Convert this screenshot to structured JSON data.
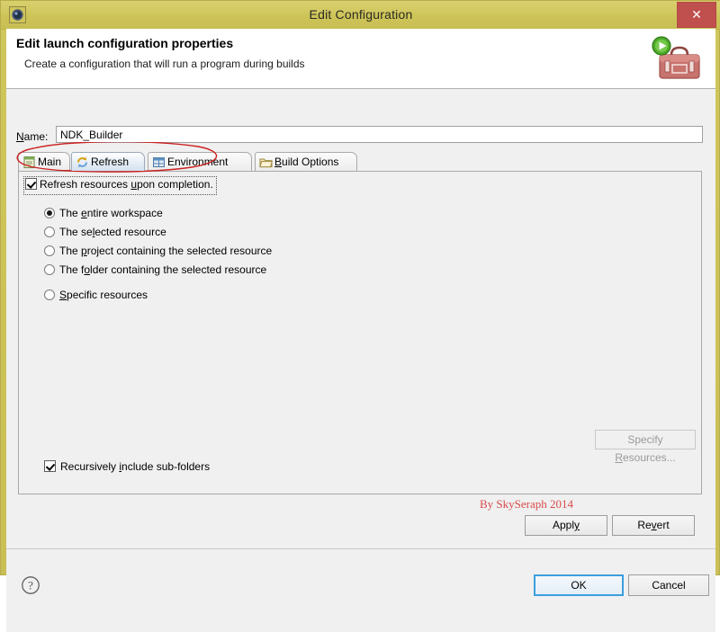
{
  "window": {
    "title": "Edit Configuration",
    "icon": "gear-icon",
    "close_label": "✕",
    "titlebar_color": "#cdc357",
    "close_color": "#c0504d"
  },
  "banner": {
    "title": "Edit launch configuration properties",
    "subtitle": "Create a configuration that will run a program during builds",
    "icon": "toolbox-with-run-badge-icon"
  },
  "name_field": {
    "label": "Name:",
    "label_mnemonic": "N",
    "value": "NDK_Builder",
    "placeholder": ""
  },
  "tabs": [
    {
      "label": "Main",
      "icon": "main-document-icon",
      "active": false,
      "mnemonic": ""
    },
    {
      "label": "Refresh",
      "icon": "refresh-arrows-icon",
      "active": true,
      "mnemonic": ""
    },
    {
      "label": "Environment",
      "icon": "environment-table-icon",
      "active": false,
      "mnemonic": ""
    },
    {
      "label": "Build Options",
      "icon": "folder-icon",
      "active": false,
      "mnemonic": "B"
    }
  ],
  "refresh_panel": {
    "enable_checkbox": {
      "label": "Refresh resources upon completion.",
      "mnemonic": "u",
      "checked": true,
      "focused": true
    },
    "scope_options": [
      {
        "label": "The entire workspace",
        "mnemonic": "e",
        "selected": true
      },
      {
        "label": "The selected resource",
        "mnemonic": "l",
        "selected": false
      },
      {
        "label": "The project containing the selected resource",
        "mnemonic": "p",
        "selected": false
      },
      {
        "label": "The folder containing the selected resource",
        "mnemonic": "o",
        "selected": false
      },
      {
        "label": "Specific resources",
        "mnemonic": "S",
        "selected": false
      }
    ],
    "recursive_checkbox": {
      "label": "Recursively include sub-folders",
      "mnemonic": "i",
      "checked": true
    },
    "specify_resources_button": {
      "label": "Specify Resources...",
      "mnemonic": "R",
      "enabled": false
    }
  },
  "watermark": {
    "text": "By SkySeraph 2014",
    "color": "#d94a4a"
  },
  "annotation": {
    "shape": "red-ellipse",
    "color": "#cc2222"
  },
  "action_buttons": {
    "apply": {
      "label": "Apply",
      "mnemonic": "y"
    },
    "revert": {
      "label": "Revert",
      "mnemonic": "v"
    }
  },
  "footer": {
    "help_icon": "question-mark-icon",
    "ok": {
      "label": "OK",
      "focused": true
    },
    "cancel": {
      "label": "Cancel"
    }
  }
}
